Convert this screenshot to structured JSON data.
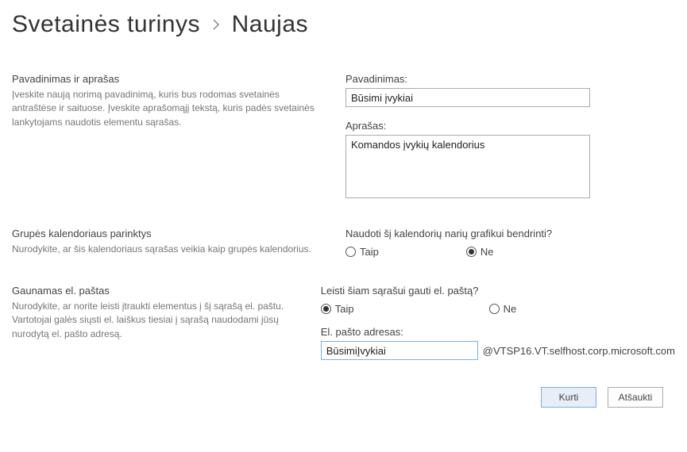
{
  "breadcrumb": {
    "part1": "Svetainės turinys",
    "part2": "Naujas"
  },
  "sections": {
    "nameDesc": {
      "heading": "Pavadinimas ir aprašas",
      "desc": "Įveskite naują norimą pavadinimą, kuris bus rodomas svetainės antraštėse ir saituose. Įveskite aprašomąjį tekstą, kuris padės svetainės lankytojams naudotis elementu sąrašas.",
      "titleLabel": "Pavadinimas:",
      "titleValue": "Būsimi įvykiai",
      "descLabel": "Aprašas:",
      "descValue": "Komandos įvykių kalendorius"
    },
    "groupCal": {
      "heading": "Grupės kalendoriaus parinktys",
      "desc": "Nurodykite, ar šis kalendoriaus sąrašas veikia kaip grupės kalendorius.",
      "question": "Naudoti šį kalendorių narių grafikui bendrinti?",
      "yes": "Taip",
      "no": "Ne",
      "selected": "no"
    },
    "email": {
      "heading": "Gaunamas el. paštas",
      "desc": "Nurodykite, ar norite leisti įtraukti elementus į šį sąrašą el. paštu. Vartotojai galės siųsti el. laiškus tiesiai į sąrašą naudodami jūsų nurodytą el. pašto adresą.",
      "question": "Leisti šiam sąrašui gauti el. paštą?",
      "yes": "Taip",
      "no": "Ne",
      "selected": "yes",
      "addrLabel": "El. pašto adresas:",
      "addrValue": "BūsimiĮvykiai",
      "addrSuffix": "@VTSP16.VT.selfhost.corp.microsoft.com"
    }
  },
  "buttons": {
    "create": "Kurti",
    "cancel": "Atšaukti"
  }
}
